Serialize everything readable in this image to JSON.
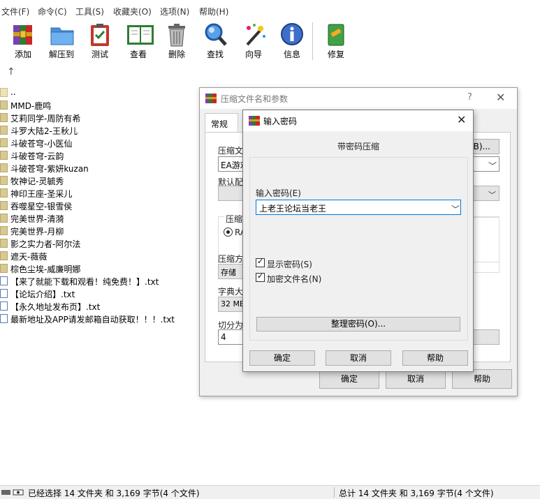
{
  "menu": [
    "文件(F)",
    "命令(C)",
    "工具(S)",
    "收藏夹(O)",
    "选项(N)",
    "帮助(H)"
  ],
  "toolbar": [
    {
      "label": "添加",
      "icon": "add-archive-icon"
    },
    {
      "label": "解压到",
      "icon": "extract-folder-icon"
    },
    {
      "label": "测试",
      "icon": "test-clipboard-icon"
    },
    {
      "label": "查看",
      "icon": "view-book-icon"
    },
    {
      "label": "删除",
      "icon": "trash-icon"
    },
    {
      "label": "查找",
      "icon": "find-magnifier-icon"
    },
    {
      "label": "向导",
      "icon": "wizard-wand-icon"
    },
    {
      "label": "信息",
      "icon": "info-icon"
    },
    {
      "label": "修复",
      "icon": "repair-icon"
    }
  ],
  "files": [
    {
      "name": "..",
      "type": "up"
    },
    {
      "name": "MMD-鹿鸣",
      "type": "folder"
    },
    {
      "name": "艾莉同学-周防有希",
      "type": "folder"
    },
    {
      "name": "斗罗大陆2-王秋儿",
      "type": "folder"
    },
    {
      "name": "斗破苍穹-小医仙",
      "type": "folder"
    },
    {
      "name": "斗破苍穹-云韵",
      "type": "folder"
    },
    {
      "name": "斗破苍穹-紫妍kuzan",
      "type": "folder"
    },
    {
      "name": "牧神记-灵毓秀",
      "type": "folder"
    },
    {
      "name": "神印王座-圣采儿",
      "type": "folder"
    },
    {
      "name": "吞噬星空-银雪侯",
      "type": "folder"
    },
    {
      "name": "完美世界-清漪",
      "type": "folder"
    },
    {
      "name": "完美世界-月柳",
      "type": "folder"
    },
    {
      "name": "影之实力者-阿尔法",
      "type": "folder"
    },
    {
      "name": "遮天-薇薇",
      "type": "folder"
    },
    {
      "name": "棕色尘埃-威廉明娜",
      "type": "folder"
    },
    {
      "name": "【来了就能下载和观看！纯免费！】.txt",
      "type": "txt"
    },
    {
      "name": "【论坛介绍】.txt",
      "type": "txt"
    },
    {
      "name": "【永久地址发布页】.txt",
      "type": "txt"
    },
    {
      "name": "最新地址及APP请发邮箱自动获取！！！.txt",
      "type": "txt"
    }
  ],
  "status": {
    "left": "已经选择 14 文件夹 和 3,169 字节(4 个文件)",
    "right": "总计 14 文件夹 和 3,169 字节(4 个文件)"
  },
  "archive_dialog": {
    "title": "压缩文件名和参数",
    "help_glyph": "?",
    "close_glyph": "✕",
    "tab": "常规",
    "archive_name_label": "压缩文",
    "archive_name_value": "EA游戏",
    "browse_label": "(B)...",
    "profile_label": "默认配",
    "format_label": "压缩",
    "format_radio": "RA",
    "method_label": "压缩方",
    "method_value": "存储",
    "dict_label": "字典大",
    "dict_value": "32 MB",
    "split_label": "切分为",
    "split_value": "4",
    "ok": "确定",
    "cancel": "取消",
    "help": "帮助"
  },
  "password_dialog": {
    "title": "输入密码",
    "close_glyph": "✕",
    "heading": "带密码压缩",
    "field_label": "输入密码(E)",
    "password_value": "上老王论坛当老王",
    "show_password": "显示密码(S)",
    "show_password_checked": true,
    "encrypt_names": "加密文件名(N)",
    "encrypt_names_checked": true,
    "organize": "整理密码(O)...",
    "ok": "确定",
    "cancel": "取消",
    "help": "帮助"
  }
}
